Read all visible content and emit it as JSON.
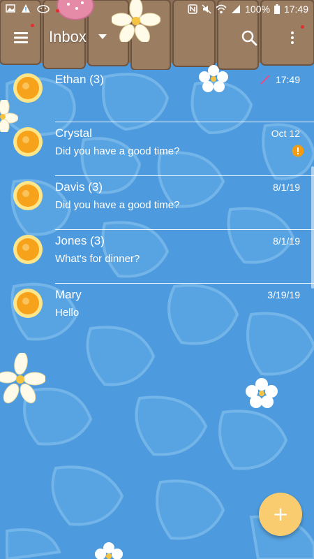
{
  "status_bar": {
    "battery": "100%",
    "time": "17:49",
    "icons_left": [
      "image-icon",
      "warning-icon",
      "cat-icon",
      "notification-dot"
    ],
    "icons_right": [
      "nfc-icon",
      "no-sound-icon",
      "wifi-icon",
      "signal-icon",
      "battery-icon"
    ]
  },
  "app_bar": {
    "title": "Inbox",
    "icons": [
      "menu-icon",
      "dropdown-caret-icon",
      "search-icon",
      "more-vert-icon"
    ]
  },
  "conversations": [
    {
      "name": "Ethan (3)",
      "date": "17:49",
      "snippet": "",
      "draft_indicator": true
    },
    {
      "name": "Crystal",
      "date": "Oct 12",
      "snippet": "Did you have a good time?",
      "failed_indicator": true
    },
    {
      "name": "Davis (3)",
      "date": "8/1/19",
      "snippet": "Did you have a good time?"
    },
    {
      "name": "Jones (3)",
      "date": "8/1/19",
      "snippet": "What's for dinner?"
    },
    {
      "name": "Mary",
      "date": "3/19/19",
      "snippet": "Hello"
    }
  ],
  "fab": {
    "label": "+"
  },
  "colors": {
    "water": "#4d9bde",
    "wood": "#8a6e55",
    "sun": "#f7a21b",
    "fab": "#f9cd6f",
    "alert": "#f39c12"
  }
}
